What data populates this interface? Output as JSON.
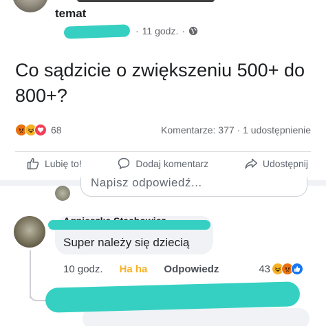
{
  "post": {
    "group_name": "temat",
    "time": "11 godz.",
    "separator": "·",
    "text": "Co sądzicie o zwiększeniu 500+ do 800+?",
    "reactions": {
      "count": "68",
      "icons": [
        "angry-icon",
        "haha-icon",
        "love-icon"
      ],
      "colors": {
        "like": "#1877f2",
        "love": "#f33e58",
        "haha": "#f7b125",
        "angry": "#e9710f"
      }
    },
    "comments_label": "Komentarze: 377",
    "shares_label": "1 udostępnienie",
    "stats_separator": "·"
  },
  "actions": {
    "like": "Lubię to!",
    "comment": "Dodaj komentarz",
    "share": "Udostępnij"
  },
  "composer": {
    "placeholder": "Napisz odpowiedź..."
  },
  "comment": {
    "author": "Agnieszka Stachowicz",
    "text": "Super należy się dziecią",
    "time": "10 godz.",
    "haha_label": "Ha ha",
    "reply_label": "Odpowiedz",
    "reaction_count": "43"
  },
  "redaction_color": "#36d0c3"
}
